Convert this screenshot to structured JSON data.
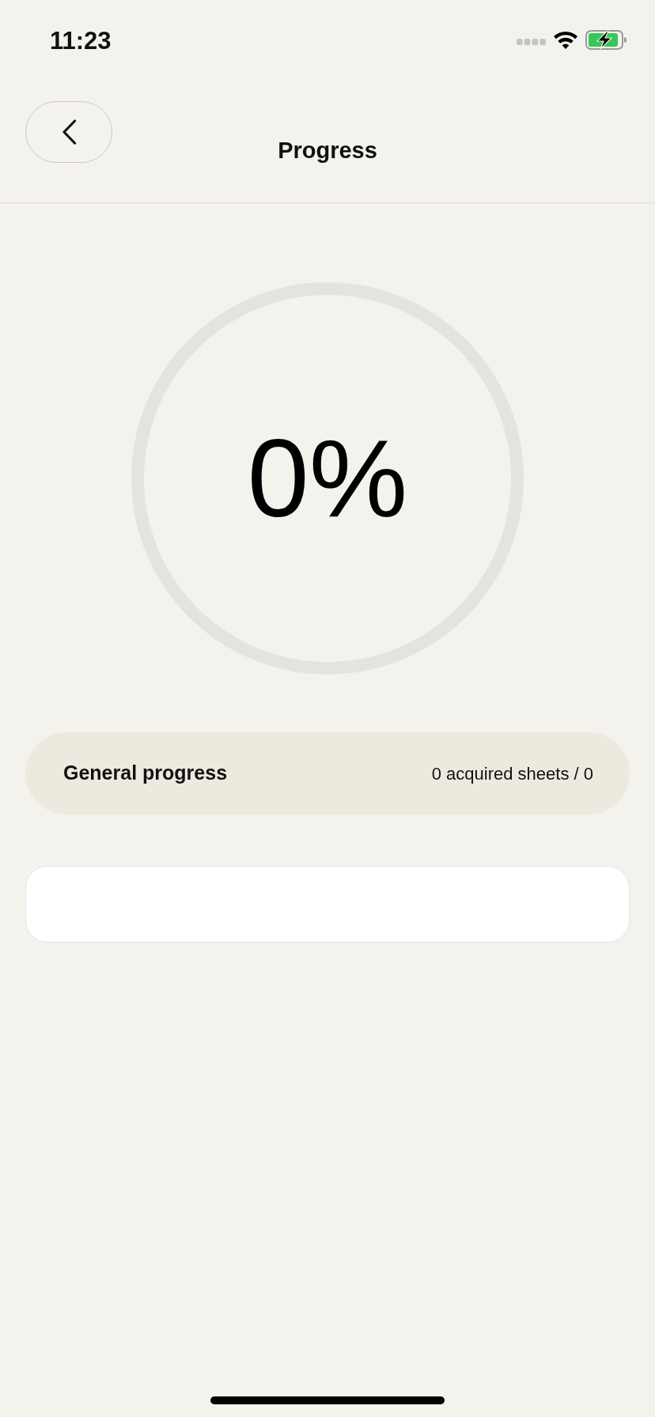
{
  "status_bar": {
    "time": "11:23"
  },
  "header": {
    "title": "Progress"
  },
  "progress_ring": {
    "reading": "0%"
  },
  "summary": {
    "label": "General progress",
    "value": "0 acquired sheets / 0"
  }
}
